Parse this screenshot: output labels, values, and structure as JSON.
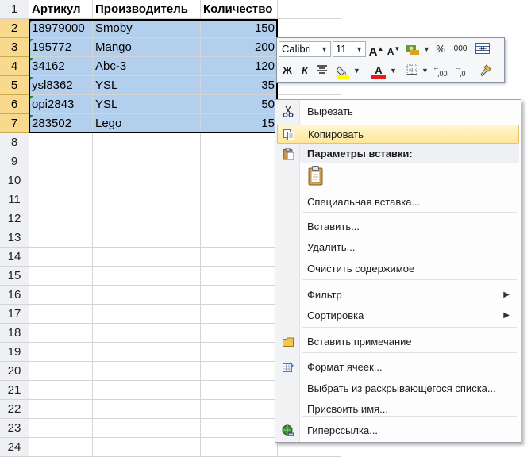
{
  "sheet": {
    "headers": [
      "Артикул",
      "Производитель",
      "Количество"
    ],
    "rows": [
      [
        "18979000",
        "Smoby",
        "150"
      ],
      [
        "195772",
        "Mango",
        "200"
      ],
      [
        "34162",
        "Abc-3",
        "120"
      ],
      [
        "ysl8362",
        "YSL",
        "35"
      ],
      [
        "opi2843",
        "YSL",
        "50"
      ],
      [
        "283502",
        "Lego",
        "15"
      ]
    ],
    "row_numbers": [
      "1",
      "2",
      "3",
      "4",
      "5",
      "6",
      "7",
      "8",
      "9",
      "10",
      "11",
      "12",
      "13",
      "14",
      "15",
      "16",
      "17",
      "18",
      "19",
      "20",
      "21",
      "22",
      "23",
      "24"
    ],
    "selected_row_numbers": [
      "2",
      "3",
      "4",
      "5",
      "6",
      "7"
    ],
    "selection_color": "#b3cfee",
    "selected_header_color": "#f9d98e",
    "number_as_text_indicator_color": "#1e8a2c"
  },
  "mini_toolbar": {
    "font_name": "Calibri",
    "font_size": "11",
    "grow_font": "A",
    "shrink_font": "A",
    "percent": "%",
    "thousands": "000",
    "bold": "Ж",
    "italic": "К",
    "increase_decimal": ",00",
    "decrease_decimal": ",0",
    "font_color": "A",
    "font_color_value": "#e31b1b",
    "highlight_color_value": "#ffff00",
    "icons": [
      "format-painter-icon",
      "accounting-format-icon",
      "merge-center-icon",
      "align-center-icon",
      "fill-color-icon",
      "borders-icon"
    ]
  },
  "context_menu": {
    "cut": "Вырезать",
    "copy": "Копировать",
    "paste_options": "Параметры вставки:",
    "paste_special": "Специальная вставка...",
    "insert": "Вставить...",
    "delete": "Удалить...",
    "clear_contents": "Очистить содержимое",
    "filter": "Фильтр",
    "sort": "Сортировка",
    "insert_comment": "Вставить примечание",
    "format_cells": "Формат ячеек...",
    "pick_from_list": "Выбрать из раскрывающегося списка...",
    "define_name": "Присвоить имя...",
    "hyperlink": "Гиперссылка...",
    "highlight_color": "#ffe79a"
  }
}
